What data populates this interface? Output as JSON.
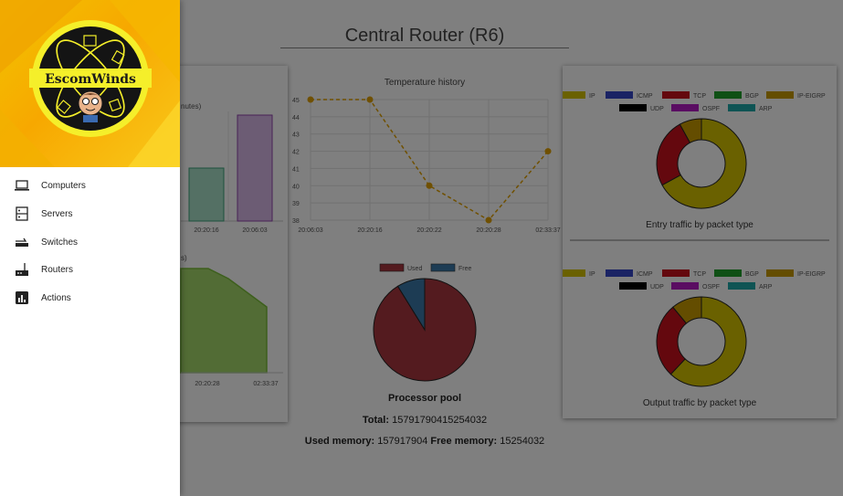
{
  "header": {
    "title": "Central Router (R6)"
  },
  "drawer": {
    "logo_text": "EscomWinds",
    "items": [
      {
        "label": "Computers",
        "icon": "laptop-icon"
      },
      {
        "label": "Servers",
        "icon": "server-icon"
      },
      {
        "label": "Switches",
        "icon": "switch-icon"
      },
      {
        "label": "Routers",
        "icon": "router-icon"
      },
      {
        "label": "Actions",
        "icon": "bar-chart-icon"
      }
    ]
  },
  "left_card": {
    "bar_label_fragment": "nutes)",
    "area_label_fragment": "s)",
    "bar_x_labels": [
      "20:20:16",
      "20:06:03"
    ],
    "area_x_labels": [
      "20:20:28",
      "02:33:37"
    ]
  },
  "temperature": {
    "title": "Temperature history"
  },
  "processor": {
    "title": "Processor pool",
    "total_label": "Total:",
    "total_value": "15791790415254032",
    "used_label": "Used memory:",
    "used_value": "157917904",
    "free_label": "Free memory:",
    "free_value": "15254032"
  },
  "entry_traffic": {
    "title": "Entry traffic by packet type"
  },
  "output_traffic": {
    "title": "Output traffic by packet type"
  },
  "colors": {
    "IP": "#d4c300",
    "ICMP": "#3547c8",
    "TCP": "#c8101c",
    "BGP": "#1ea12a",
    "IP-EIGRP": "#c99a00",
    "UDP": "#000000",
    "OSPF": "#b41ac4",
    "ARP": "#1ea8a8",
    "Used": "#a8363e",
    "Free": "#3a78a8",
    "temp_line": "#e0a100"
  },
  "chart_data": [
    {
      "type": "line",
      "title": "Temperature history",
      "x": [
        "20:06:03",
        "20:20:16",
        "20:20:22",
        "20:20:28",
        "02:33:37"
      ],
      "series": [
        {
          "values": [
            45,
            45,
            40,
            38,
            42
          ]
        }
      ],
      "ylim": [
        38,
        45
      ],
      "yticks": [
        38,
        39,
        40,
        41,
        42,
        43,
        44,
        45
      ],
      "grid": true
    },
    {
      "type": "pie",
      "labels": [
        "Used",
        "Free"
      ],
      "values": [
        157917904,
        15254032
      ],
      "legend": "top"
    },
    {
      "type": "pie",
      "title": "Entry traffic by packet type",
      "labels": [
        "IP",
        "ICMP",
        "TCP",
        "BGP",
        "IP-EIGRP",
        "UDP",
        "OSPF",
        "ARP"
      ],
      "values": [
        67,
        0,
        25,
        0,
        8,
        0,
        0,
        0
      ],
      "legend": "top"
    },
    {
      "type": "pie",
      "title": "Output traffic by packet type",
      "labels": [
        "IP",
        "ICMP",
        "TCP",
        "BGP",
        "IP-EIGRP",
        "UDP",
        "OSPF",
        "ARP"
      ],
      "values": [
        62,
        0,
        27,
        0,
        11,
        0,
        0,
        0
      ],
      "legend": "top"
    }
  ]
}
